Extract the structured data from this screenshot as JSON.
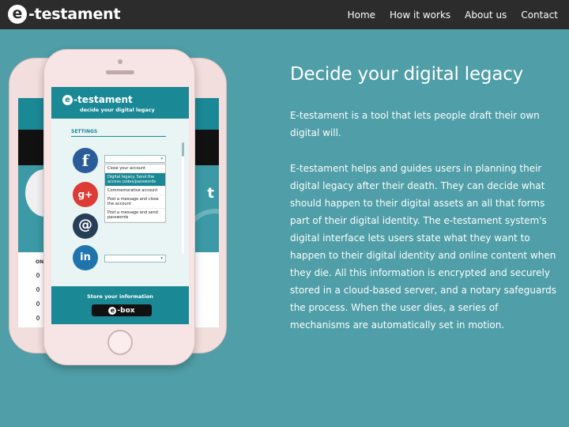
{
  "brand": {
    "logo_letter": "e",
    "logo_text": "-testament"
  },
  "nav": {
    "items": [
      "Home",
      "How it works",
      "About us",
      "Contact"
    ]
  },
  "phone_app": {
    "logo_letter": "e",
    "logo_text": "-testament",
    "subtitle": "decide your digital legacy",
    "settings_label": "SETTINGS",
    "social_icons": [
      "facebook-icon",
      "google-plus-icon",
      "at-email-icon",
      "linkedin-icon"
    ],
    "social_glyphs": {
      "facebook": "f",
      "google_plus": "g+",
      "email": "@",
      "linkedin": "in"
    },
    "dropdown_caret": "▾",
    "menu_items": [
      "Close your account",
      "Digital legacy. Send the access codes/passwords",
      "Commemorative account",
      "Post a message and close the account",
      "Post a message and send passwords"
    ],
    "active_menu_index": 1,
    "store_label": "Store your information",
    "ebox_letter": "e",
    "ebox_text": "-box"
  },
  "back_phone": {
    "big_letter": "t",
    "list_label": "ONLI"
  },
  "content": {
    "title": "Decide your digital legacy",
    "paragraph_1": "E-testament is a tool that lets people draft their own digital will.",
    "paragraph_2": "E-testament helps and guides users in planning their digital legacy after their death. They can decide what should happen to their digital assets an all that forms part of their digital identity. The e-testament system's digital interface lets users state what they want to happen to their digital identity and online content when they die. All this information is encrypted and securely stored in a cloud-based server, and a notary safeguards the process. When the user dies, a series of mechanisms are automatically set in motion."
  },
  "colors": {
    "background": "#4f9ea8",
    "navbar": "#2c2c2c",
    "app_teal": "#1a8895",
    "facebook": "#2b5c9a",
    "google_plus": "#dd3b35",
    "email": "#263f56",
    "linkedin": "#1f74ad"
  }
}
